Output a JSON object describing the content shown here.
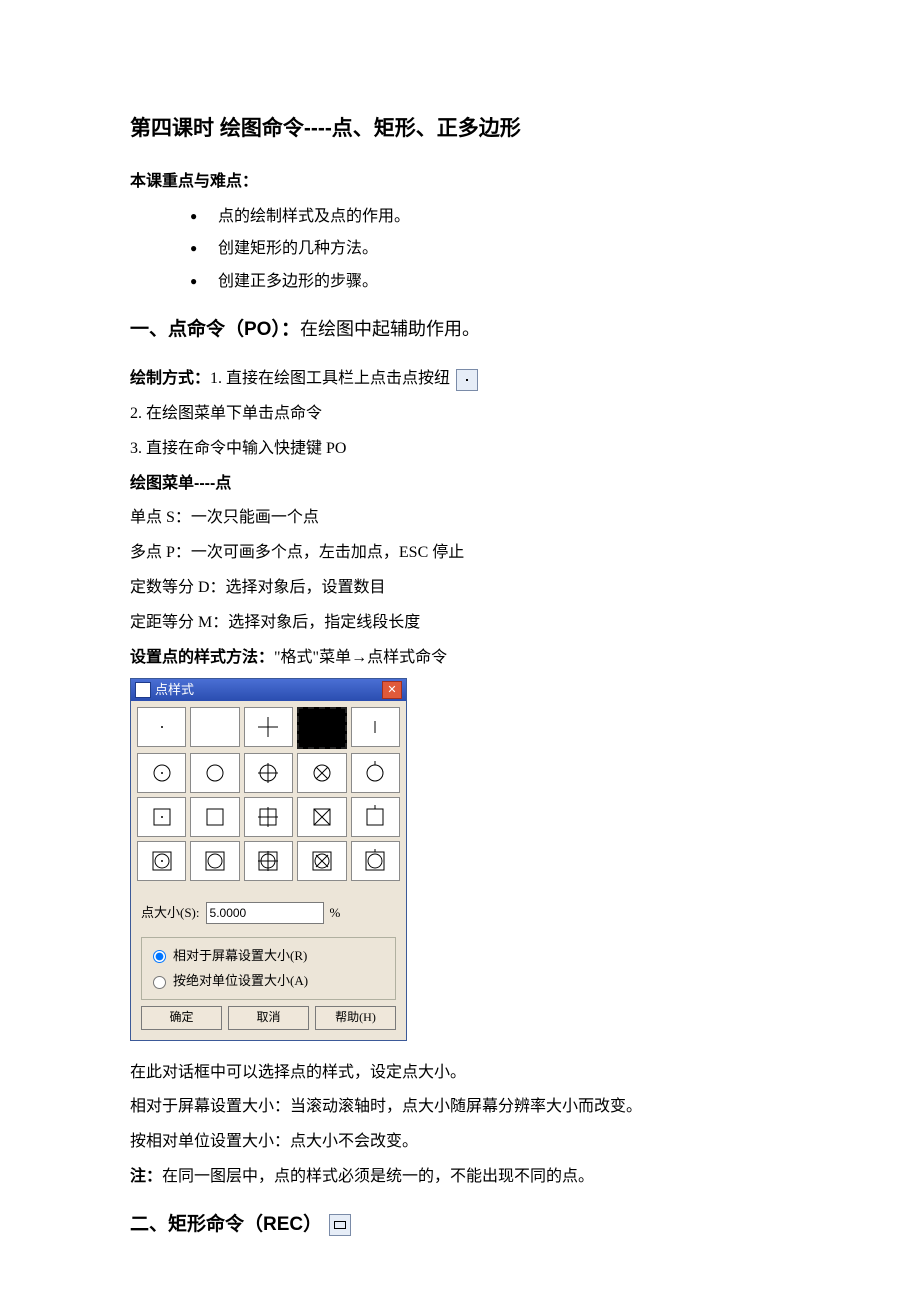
{
  "title": "第四课时   绘图命令----点、矩形、正多边形",
  "key_points_heading": "本课重点与难点：",
  "key_points": [
    "点的绘制样式及点的作用。",
    "创建矩形的几种方法。",
    "创建正多边形的步骤。"
  ],
  "section1": {
    "heading_bold": "一、点命令（PO）：",
    "heading_rest": "在绘图中起辅助作用。"
  },
  "draw_methods": {
    "label": "绘制方式：",
    "m1": "1. 直接在绘图工具栏上点击点按纽",
    "m2": "2. 在绘图菜单下单击点命令",
    "m3": "3. 直接在命令中输入快捷键 PO"
  },
  "menu_heading": "绘图菜单----点",
  "point_cmds": [
    "单点 S：一次只能画一个点",
    "多点 P：一次可画多个点，左击加点，ESC 停止",
    "定数等分 D：选择对象后，设置数目",
    "定距等分 M：选择对象后，指定线段长度"
  ],
  "style_heading_bold": "设置点的样式方法：",
  "style_heading_rest": "\"格式\"菜单→点样式命令",
  "dialog": {
    "title": "点样式",
    "size_label": "点大小(S):",
    "size_value": "5.0000",
    "size_unit": "%",
    "radio1": "相对于屏幕设置大小(R)",
    "radio2": "按绝对单位设置大小(A)",
    "btn_ok": "确定",
    "btn_cancel": "取消",
    "btn_help": "帮助(H)"
  },
  "after_dialog": [
    "在此对话框中可以选择点的样式，设定点大小。",
    "相对于屏幕设置大小：当滚动滚轴时，点大小随屏幕分辨率大小而改变。",
    "按相对单位设置大小：点大小不会改变。"
  ],
  "note_bold": "注：",
  "note_rest": "在同一图层中，点的样式必须是统一的，不能出现不同的点。",
  "section2_heading": "二、矩形命令（REC）"
}
